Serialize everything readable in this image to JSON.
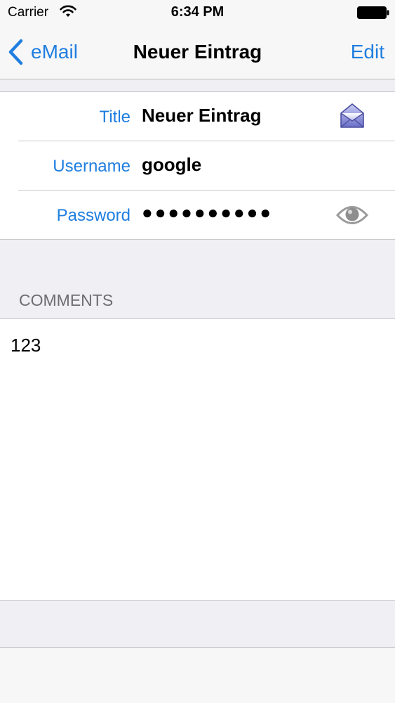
{
  "status_bar": {
    "carrier": "Carrier",
    "time": "6:34 PM",
    "wifi_icon": "wifi-icon",
    "battery_icon": "battery-icon"
  },
  "nav": {
    "back_label": "eMail",
    "title": "Neuer Eintrag",
    "edit_label": "Edit",
    "accent_color": "#1f7ee0"
  },
  "form": {
    "title_label": "Title",
    "title_value": "Neuer Eintrag",
    "title_icon": "envelope-icon",
    "username_label": "Username",
    "username_value": "google",
    "password_label": "Password",
    "password_value": "●●●●●●●●●●",
    "password_icon": "eye-icon"
  },
  "comments": {
    "header": "COMMENTS",
    "text": "123"
  }
}
